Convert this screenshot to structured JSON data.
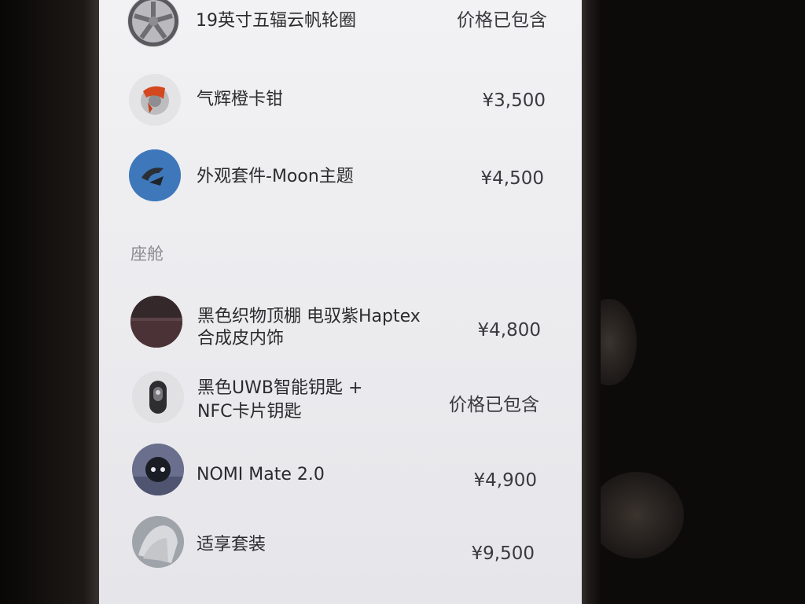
{
  "exterior_items": [
    {
      "name": "19英寸五辐云帆轮圈",
      "price": "价格已包含",
      "icon": "wheel-icon"
    },
    {
      "name": "气辉橙卡钳",
      "price": "¥3,500",
      "icon": "brake-caliper-icon"
    },
    {
      "name": "外观套件-Moon主题",
      "price": "¥4,500",
      "icon": "moon-theme-icon"
    }
  ],
  "cabin_section": {
    "title": "座舱",
    "items": [
      {
        "line1": "黑色织物顶棚 电驭紫Haptex",
        "line2": "合成皮内饰",
        "price": "¥4,800",
        "icon": "interior-icon"
      },
      {
        "line1": "黑色UWB智能钥匙 +",
        "line2": "NFC卡片钥匙",
        "price": "价格已包含",
        "icon": "key-icon"
      },
      {
        "name": "NOMI Mate 2.0",
        "price": "¥4,900",
        "icon": "nomi-robot-icon"
      },
      {
        "name": "适享套装",
        "price": "¥9,500",
        "icon": "seat-package-icon"
      }
    ]
  },
  "colors": {
    "screen_bg": "#efeff2",
    "text_primary": "#2b2b2e",
    "text_secondary": "#8a8a90"
  }
}
